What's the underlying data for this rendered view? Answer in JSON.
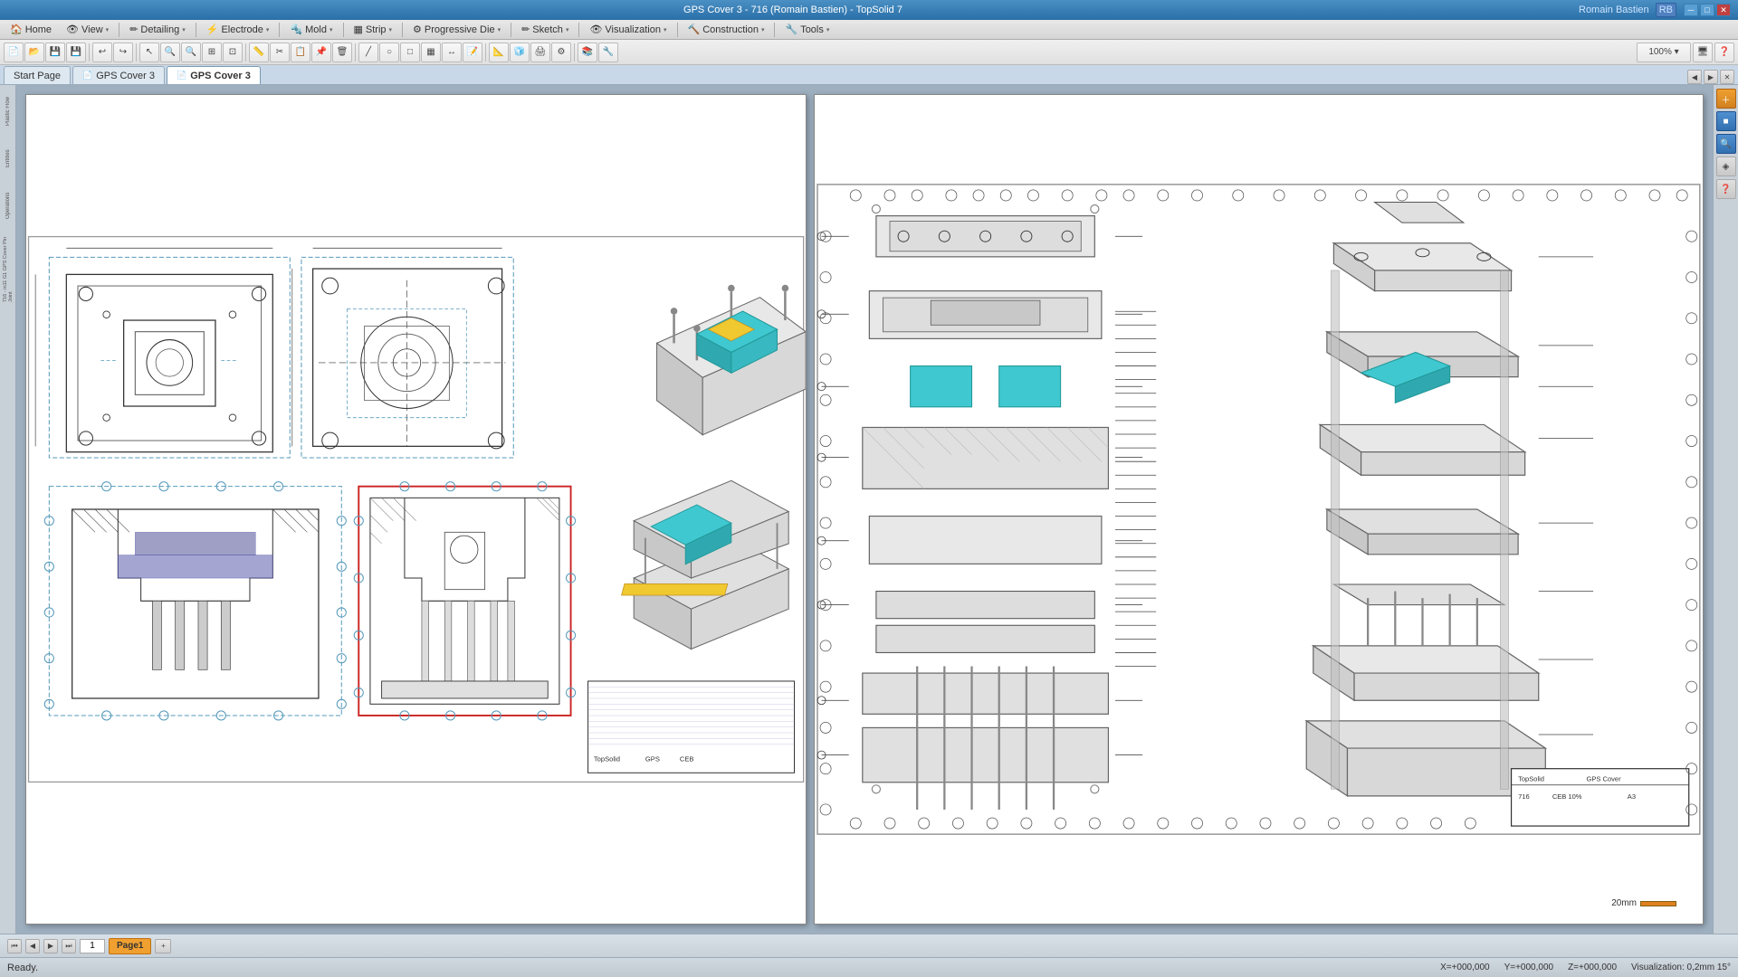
{
  "titleBar": {
    "title": "GPS Cover 3 - 716 (Romain Bastien) - TopSolid 7",
    "user": "Romain Bastien",
    "userInitials": "RB",
    "minBtn": "─",
    "maxBtn": "□",
    "closeBtn": "✕"
  },
  "menuBar": {
    "items": [
      {
        "label": "Home",
        "icon": "🏠"
      },
      {
        "label": "View",
        "icon": "👁"
      },
      {
        "label": "Detailing",
        "icon": "✏"
      },
      {
        "label": "Electrode",
        "icon": "⚡"
      },
      {
        "label": "Mold",
        "icon": "🔧"
      },
      {
        "label": "Strip",
        "icon": "▦"
      },
      {
        "label": "Progressive Die",
        "icon": "⚙"
      },
      {
        "label": "Sketch",
        "icon": "✏"
      },
      {
        "label": "Visualization",
        "icon": "👁"
      },
      {
        "label": "Construction",
        "icon": "🔨"
      },
      {
        "label": "Tools",
        "icon": "🔧"
      }
    ]
  },
  "tabs": {
    "items": [
      {
        "label": "Start Page",
        "active": false,
        "closeable": false
      },
      {
        "label": "GPS Cover 3",
        "active": false,
        "closeable": false
      },
      {
        "label": "GPS Cover 3",
        "active": true,
        "closeable": false
      }
    ]
  },
  "leftPanel": {
    "items": [
      {
        "label": "Plastic Flow"
      },
      {
        "label": "Entities"
      },
      {
        "label": "Operations"
      },
      {
        "label": "716 - m11 G1 GPS Cover Pin Joint"
      }
    ]
  },
  "bottomBar": {
    "currentPage": "1",
    "pageTabs": [
      "Page1"
    ],
    "scaleText": "20mm"
  },
  "statusBar": {
    "ready": "Ready.",
    "xCoord": "X=+000,000",
    "yCoord": "Y=+000,000",
    "zCoord": "Z=+000,000",
    "visualization": "Visualization: 0,2mm 15°"
  },
  "rightPanel": {
    "icons": [
      "＋",
      "■",
      "🔍",
      "◈",
      "❓"
    ]
  }
}
